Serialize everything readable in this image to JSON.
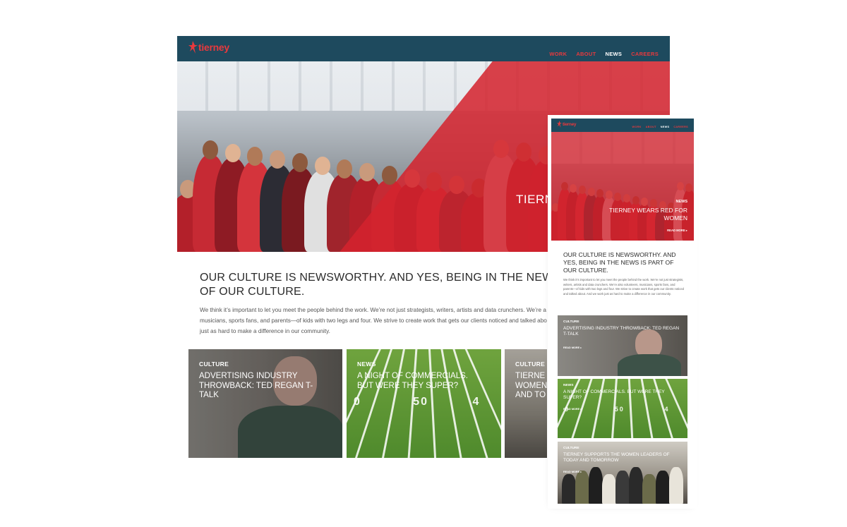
{
  "brand": {
    "name": "tierney",
    "accent": "#e8393d",
    "nav_bg": "#1e4a5e"
  },
  "nav": {
    "items": [
      {
        "label": "WORK",
        "active": false
      },
      {
        "label": "ABOUT",
        "active": false
      },
      {
        "label": "NEWS",
        "active": true
      },
      {
        "label": "CAREERS",
        "active": false
      }
    ]
  },
  "desktop": {
    "hero_title": "TIERNEY WEARS RED FOR WOMEN",
    "hero_title_visible": "TIERN",
    "intro": {
      "heading": "OUR CULTURE IS NEWSWORTHY. AND YES, BEING IN THE NEWS IS PART OF OUR CULTURE.",
      "heading_visible": "OUR CULTURE IS NEWSWORTHY. AND YES, BEING IN THE NEWS\nOF OUR CULTURE.",
      "body_visible": "We think it’s important to let you meet the people behind the work. We’re not just strategists, writers, artists and data crunchers.  We’re a\nmusicians, sports fans, and parents—of kids with two legs and four. We strive to create work that gets our clients noticed and talked abo\njust as hard to make a difference in our community."
    },
    "cards": [
      {
        "category": "CULTURE",
        "title": "ADVERTISING INDUSTRY THROWBACK: TED REGAN T-TALK"
      },
      {
        "category": "NEWS",
        "title": "A NIGHT OF COMMERCIALS. BUT WERE THEY SUPER?"
      },
      {
        "category": "CULTURE",
        "title_visible": "TIERNE\nWOMEN\nAND TO"
      }
    ]
  },
  "mobile": {
    "hero": {
      "category": "NEWS",
      "title": "TIERNEY WEARS RED FOR WOMEN",
      "read_more": "READ MORE ▸"
    },
    "intro": {
      "heading": "OUR CULTURE IS NEWSWORTHY. AND YES, BEING IN THE NEWS IS PART OF OUR CULTURE.",
      "body": "We think it’s important to let you meet the people behind the work. We’re not just strategists, writers, artists and data crunchers.  We’re also volunteers, musicians, sports fans, and parents—of kids with two legs and four. We strive to create work that gets our clients noticed and talked about.  And we work just as hard to make a difference in our community."
    },
    "cards": [
      {
        "category": "CULTURE",
        "title": "ADVERTISING INDUSTRY THROWBACK: TED REGAN T-TALK",
        "read_more": "READ MORE ▸"
      },
      {
        "category": "NEWS",
        "title": "A NIGHT OF COMMERCIALS. BUT WERE THEY SUPER?",
        "read_more": "READ MORE ▸"
      },
      {
        "category": "CULTURE",
        "title": "TIERNEY SUPPORTS THE WOMEN LEADERS OF TODAY AND TOMORROW",
        "read_more": "READ MORE ▸"
      }
    ]
  },
  "field_numbers": [
    "0",
    "50",
    "4"
  ]
}
